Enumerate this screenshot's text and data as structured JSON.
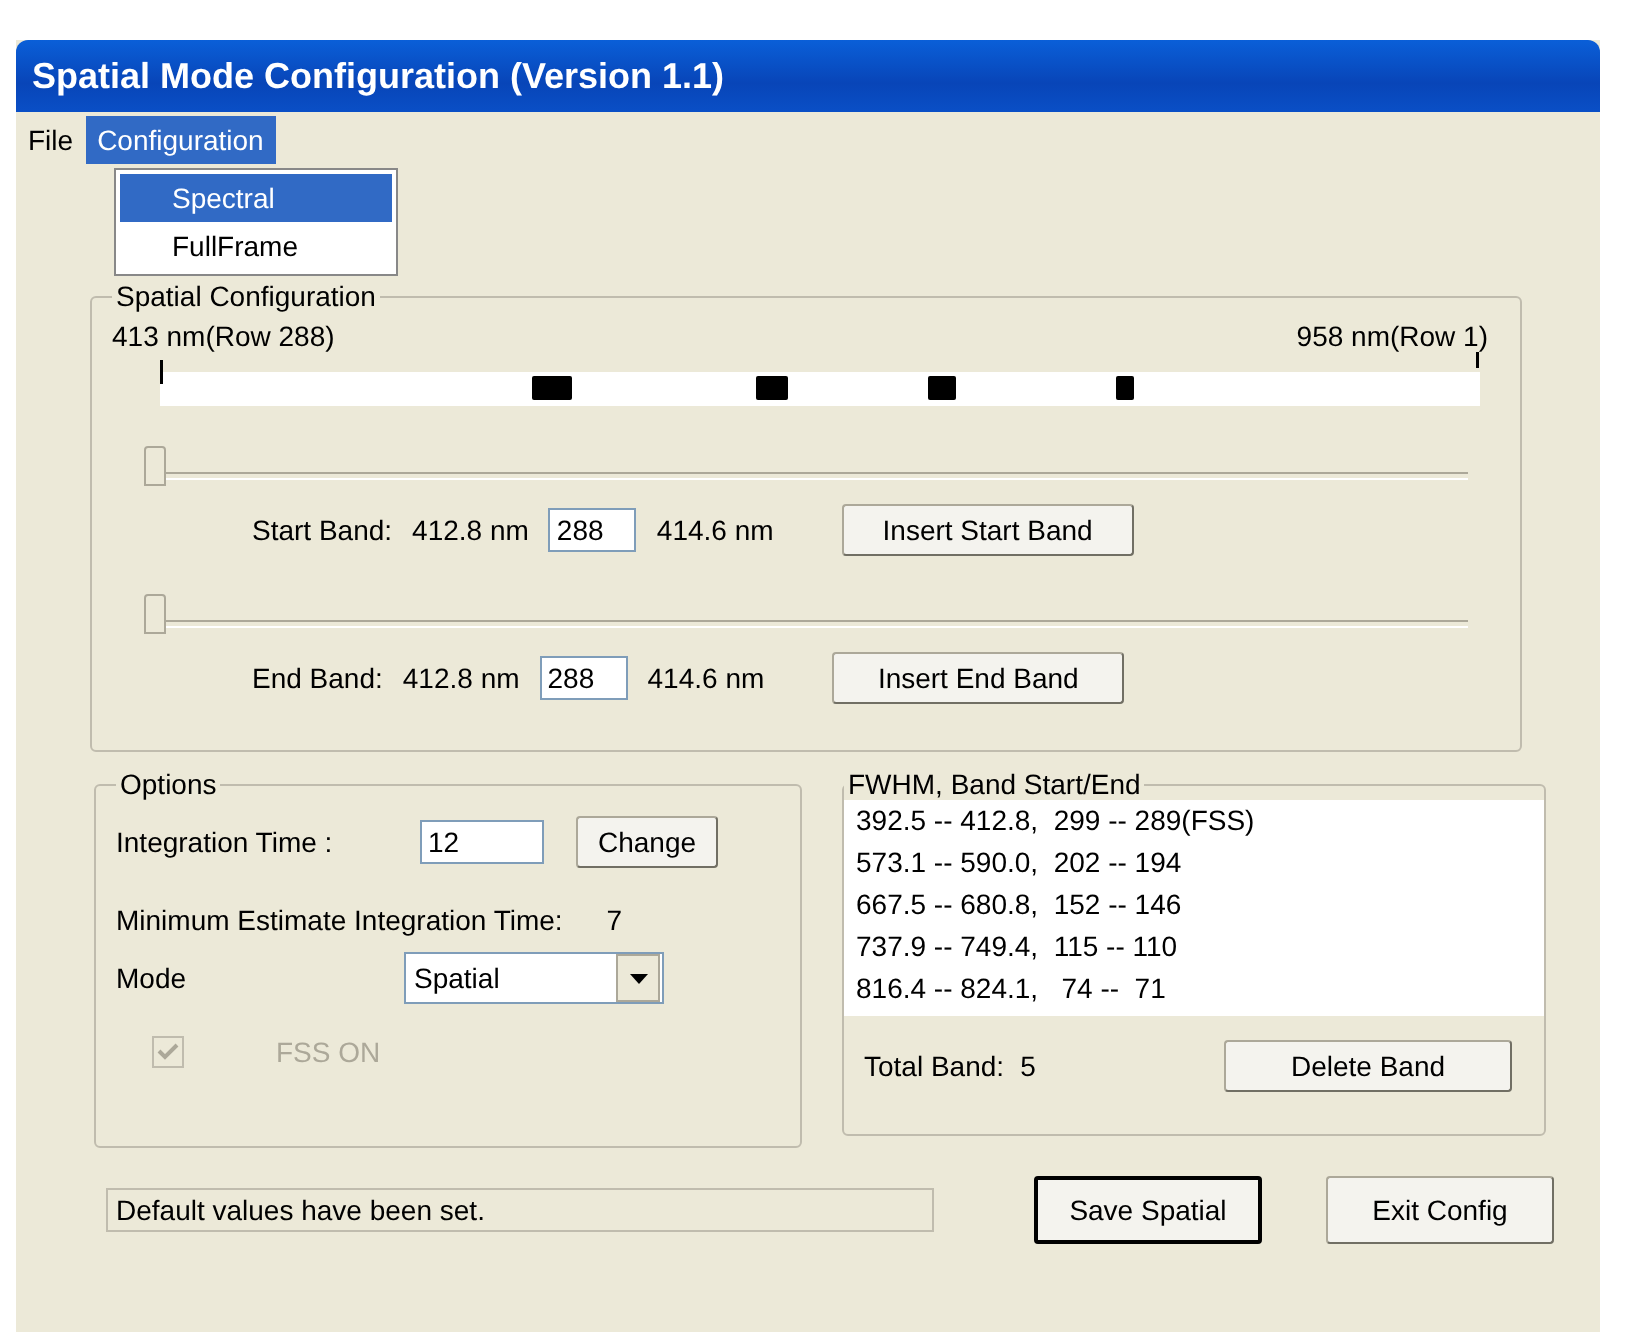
{
  "window": {
    "title": "Spatial Mode Configuration (Version 1.1)"
  },
  "menu": [
    {
      "label": "File",
      "selected": false
    },
    {
      "label": "Configuration",
      "selected": true
    }
  ],
  "dropdown": [
    {
      "label": "Spectral",
      "selected": true
    },
    {
      "label": "FullFrame",
      "selected": false
    }
  ],
  "spatial_configuration": {
    "title": "Spatial Configuration",
    "left_label": "413 nm(Row 288)",
    "right_label": "958 nm(Row 1)",
    "bands": [
      {
        "label": "Start Band:",
        "low": "412.8 nm",
        "value": "288",
        "high": "414.6 nm",
        "button": "Insert Start Band",
        "level": 0
      },
      {
        "label": "End Band:",
        "low": "412.8 nm",
        "value": "288",
        "high": "414.6 nm",
        "button": "Insert End Band",
        "level": 0
      }
    ]
  },
  "options": {
    "title": "Options",
    "integration_label": "Integration Time :",
    "integration_value": "12",
    "change_button": "Change",
    "min_label": "Minimum Estimate Integration Time:",
    "min_value": "7",
    "mode_label": "Mode",
    "mode_value": "Spatial",
    "fss": {
      "label": "FSS ON",
      "checked": true,
      "disabled": true
    }
  },
  "fwhm": {
    "title": "FWHM,  Band Start/End",
    "rows": [
      "392.5 -- 412.8,  299 -- 289(FSS)",
      "573.1 -- 590.0,  202 -- 194",
      "667.5 -- 680.8,  152 -- 146",
      "737.9 -- 749.4,  115 -- 110",
      "816.4 -- 824.1,   74 --  71"
    ],
    "total_label": "Total Band:",
    "total_value": "5",
    "delete_button": "Delete Band"
  },
  "status": "Default values have been set.",
  "buttons": [
    {
      "label": "Save Spatial",
      "default": true
    },
    {
      "label": "Exit Config",
      "default": false
    }
  ]
}
